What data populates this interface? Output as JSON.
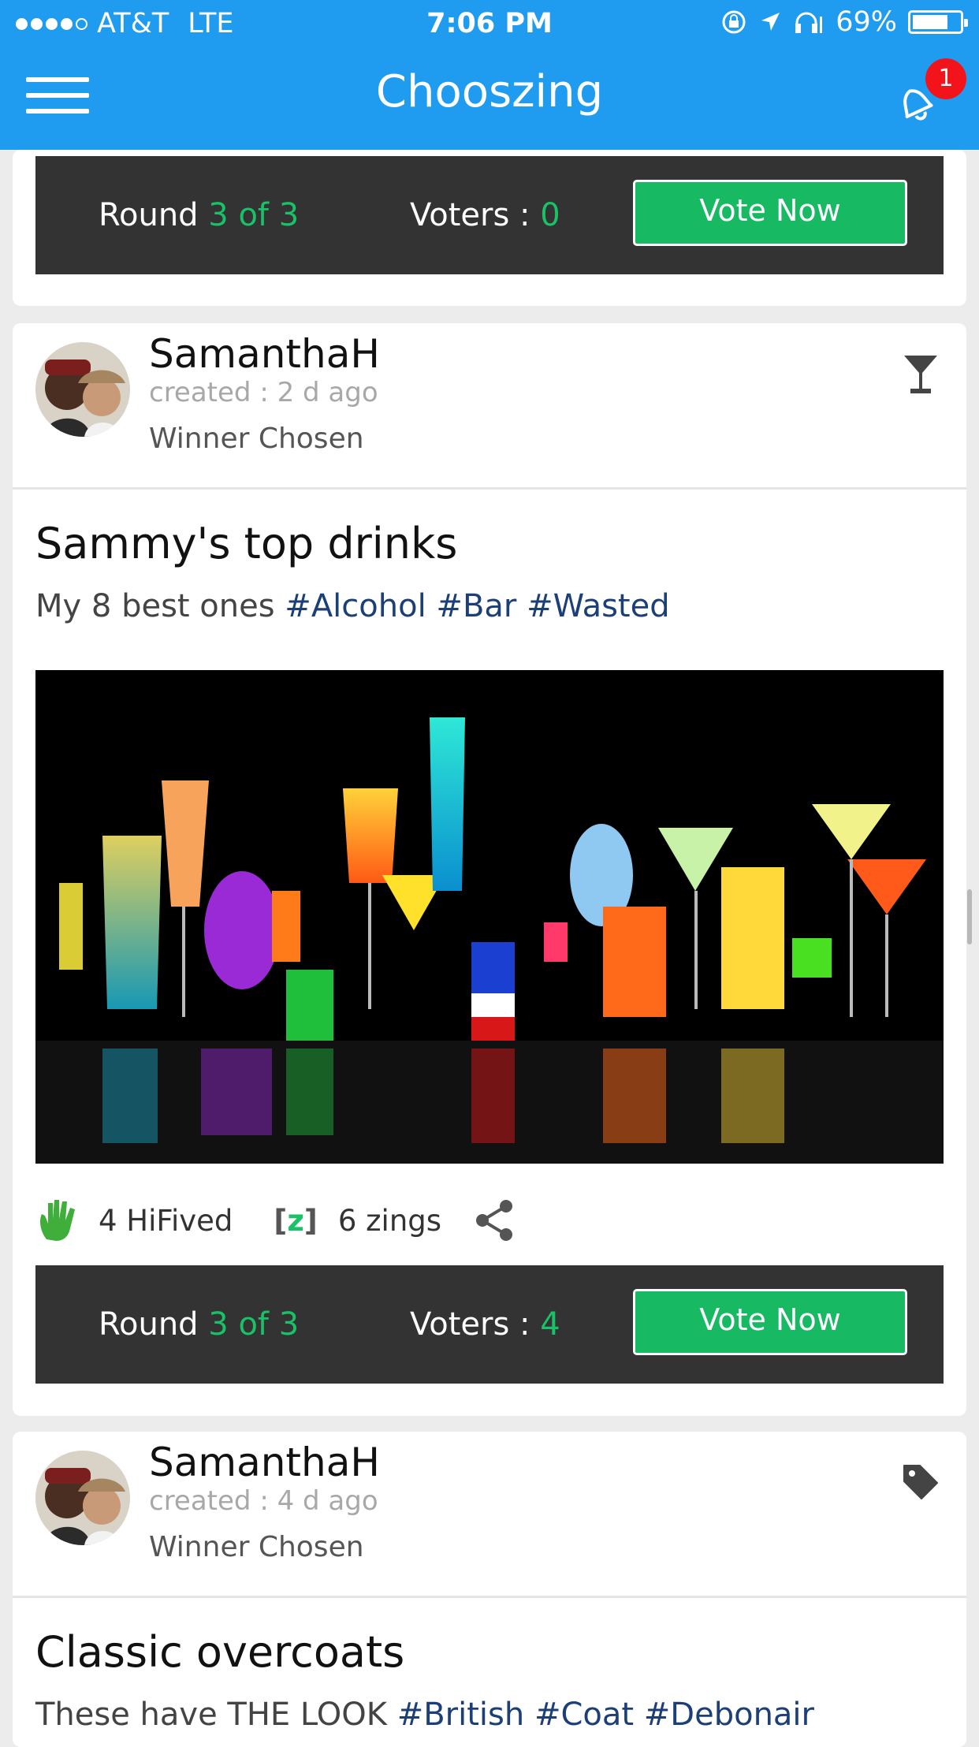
{
  "status_bar": {
    "carrier": "AT&T",
    "network": "LTE",
    "time": "7:06 PM",
    "battery": "69%",
    "icons": [
      "orientation-lock-icon",
      "location-arrow-icon",
      "headphones-icon"
    ]
  },
  "navbar": {
    "title": "Chooszing",
    "notification_count": "1"
  },
  "posts": [
    {
      "round_label": "Round",
      "round_value": "3 of 3",
      "voters_label": "Voters : ",
      "voters_value": "0",
      "vote_button": "Vote Now"
    },
    {
      "username": "SamanthaH",
      "created": "created : 2 d ago",
      "status": "Winner Chosen",
      "type_icon": "cocktail-glass-icon",
      "title": "Sammy's top drinks",
      "description": "My 8 best ones",
      "tags": [
        "#Alcohol",
        "#Bar",
        "#Wasted"
      ],
      "hifived": "4 HiFived",
      "zings": "6 zings",
      "round_label": "Round",
      "round_value": "3 of 3",
      "voters_label": "Voters : ",
      "voters_value": "4",
      "vote_button": "Vote Now"
    },
    {
      "username": "SamanthaH",
      "created": "created : 4 d ago",
      "status": "Winner Chosen",
      "type_icon": "tag-icon",
      "title": "Classic overcoats",
      "description": "These have THE LOOK",
      "tags": [
        "#British",
        "#Coat",
        "#Debonair"
      ]
    }
  ],
  "colors": {
    "brand_blue": "#1f9cf0",
    "accent_green": "#1ac166",
    "vote_button": "#17b963",
    "round_bar": "#333333",
    "hashtag": "#1c3f78",
    "badge_red": "#f3141b"
  }
}
